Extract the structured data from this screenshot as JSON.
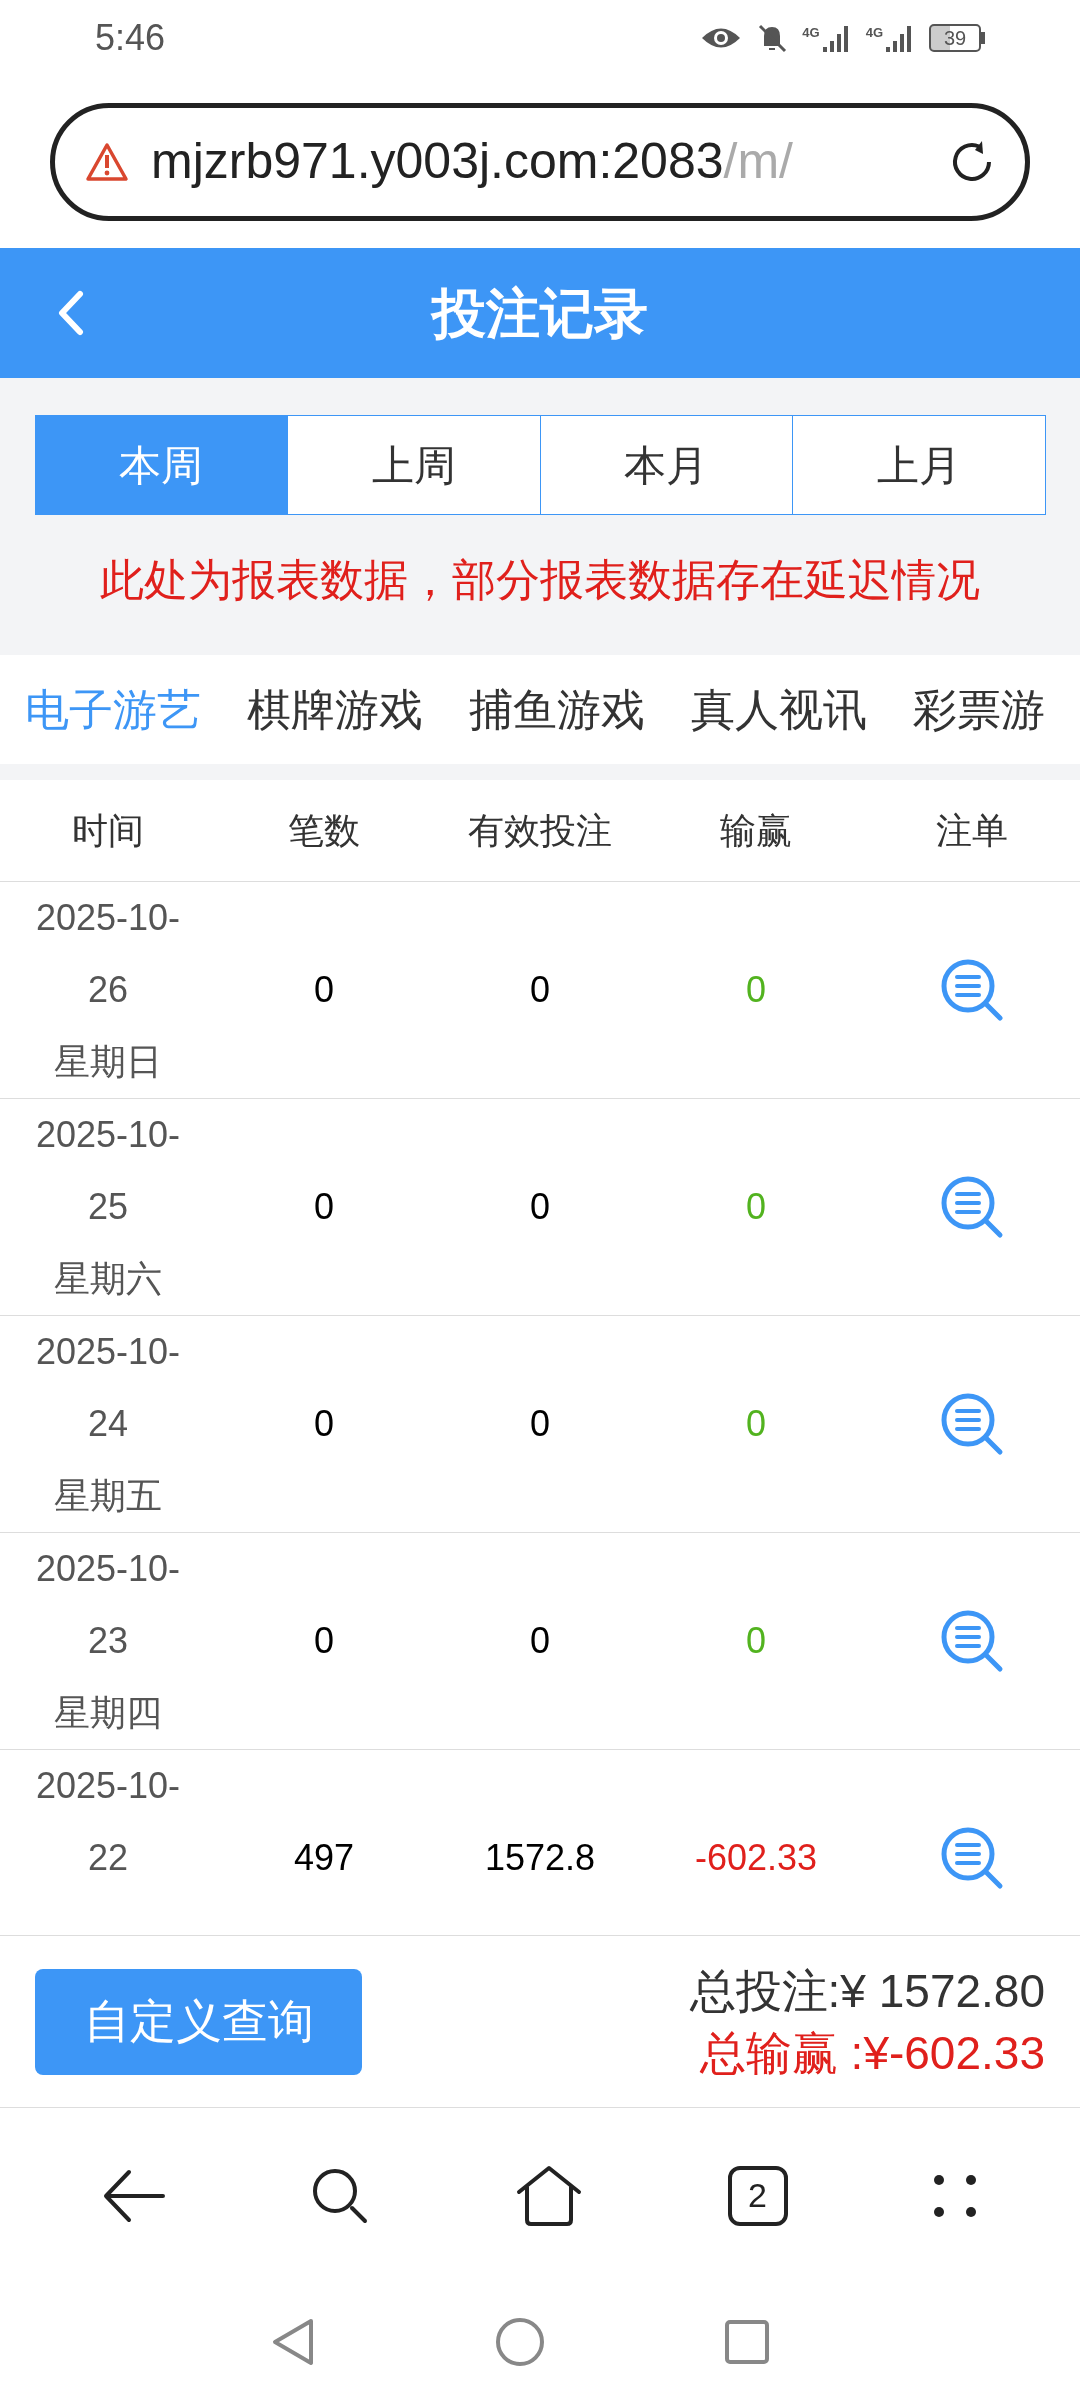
{
  "status_bar": {
    "time": "5:46",
    "network_1": "4G",
    "network_2": "4G",
    "battery": "39"
  },
  "address_bar": {
    "url_main": "mjzrb971.y003j.com:2083",
    "url_rest": "/m/"
  },
  "header": {
    "title": "投注记录"
  },
  "period_tabs": [
    {
      "label": "本周",
      "selected": true
    },
    {
      "label": "上周",
      "selected": false
    },
    {
      "label": "本月",
      "selected": false
    },
    {
      "label": "上月",
      "selected": false
    }
  ],
  "notice": "此处为报表数据，部分报表数据存在延迟情况",
  "category_tabs": [
    {
      "label": "电子游艺",
      "selected": true
    },
    {
      "label": "棋牌游戏",
      "selected": false
    },
    {
      "label": "捕鱼游戏",
      "selected": false
    },
    {
      "label": "真人视讯",
      "selected": false
    },
    {
      "label": "彩票游",
      "selected": false
    }
  ],
  "table": {
    "columns": [
      "时间",
      "笔数",
      "有效投注",
      "输赢",
      "注单"
    ],
    "rows": [
      {
        "date": "2025-10-26",
        "weekday": "星期日",
        "count": "0",
        "valid_bet": "0",
        "win_loss": "0",
        "negative": false
      },
      {
        "date": "2025-10-25",
        "weekday": "星期六",
        "count": "0",
        "valid_bet": "0",
        "win_loss": "0",
        "negative": false
      },
      {
        "date": "2025-10-24",
        "weekday": "星期五",
        "count": "0",
        "valid_bet": "0",
        "win_loss": "0",
        "negative": false
      },
      {
        "date": "2025-10-23",
        "weekday": "星期四",
        "count": "0",
        "valid_bet": "0",
        "win_loss": "0",
        "negative": false
      },
      {
        "date": "2025-10-22",
        "count": "497",
        "valid_bet": "1572.8",
        "win_loss": "-602.33",
        "negative": true
      }
    ]
  },
  "footer": {
    "button": "自定义查询",
    "total_bet": "总投注:¥ 1572.80",
    "total_win_loss": "总输赢 :¥-602.33"
  },
  "browser_nav": {
    "tab_count": "2"
  }
}
